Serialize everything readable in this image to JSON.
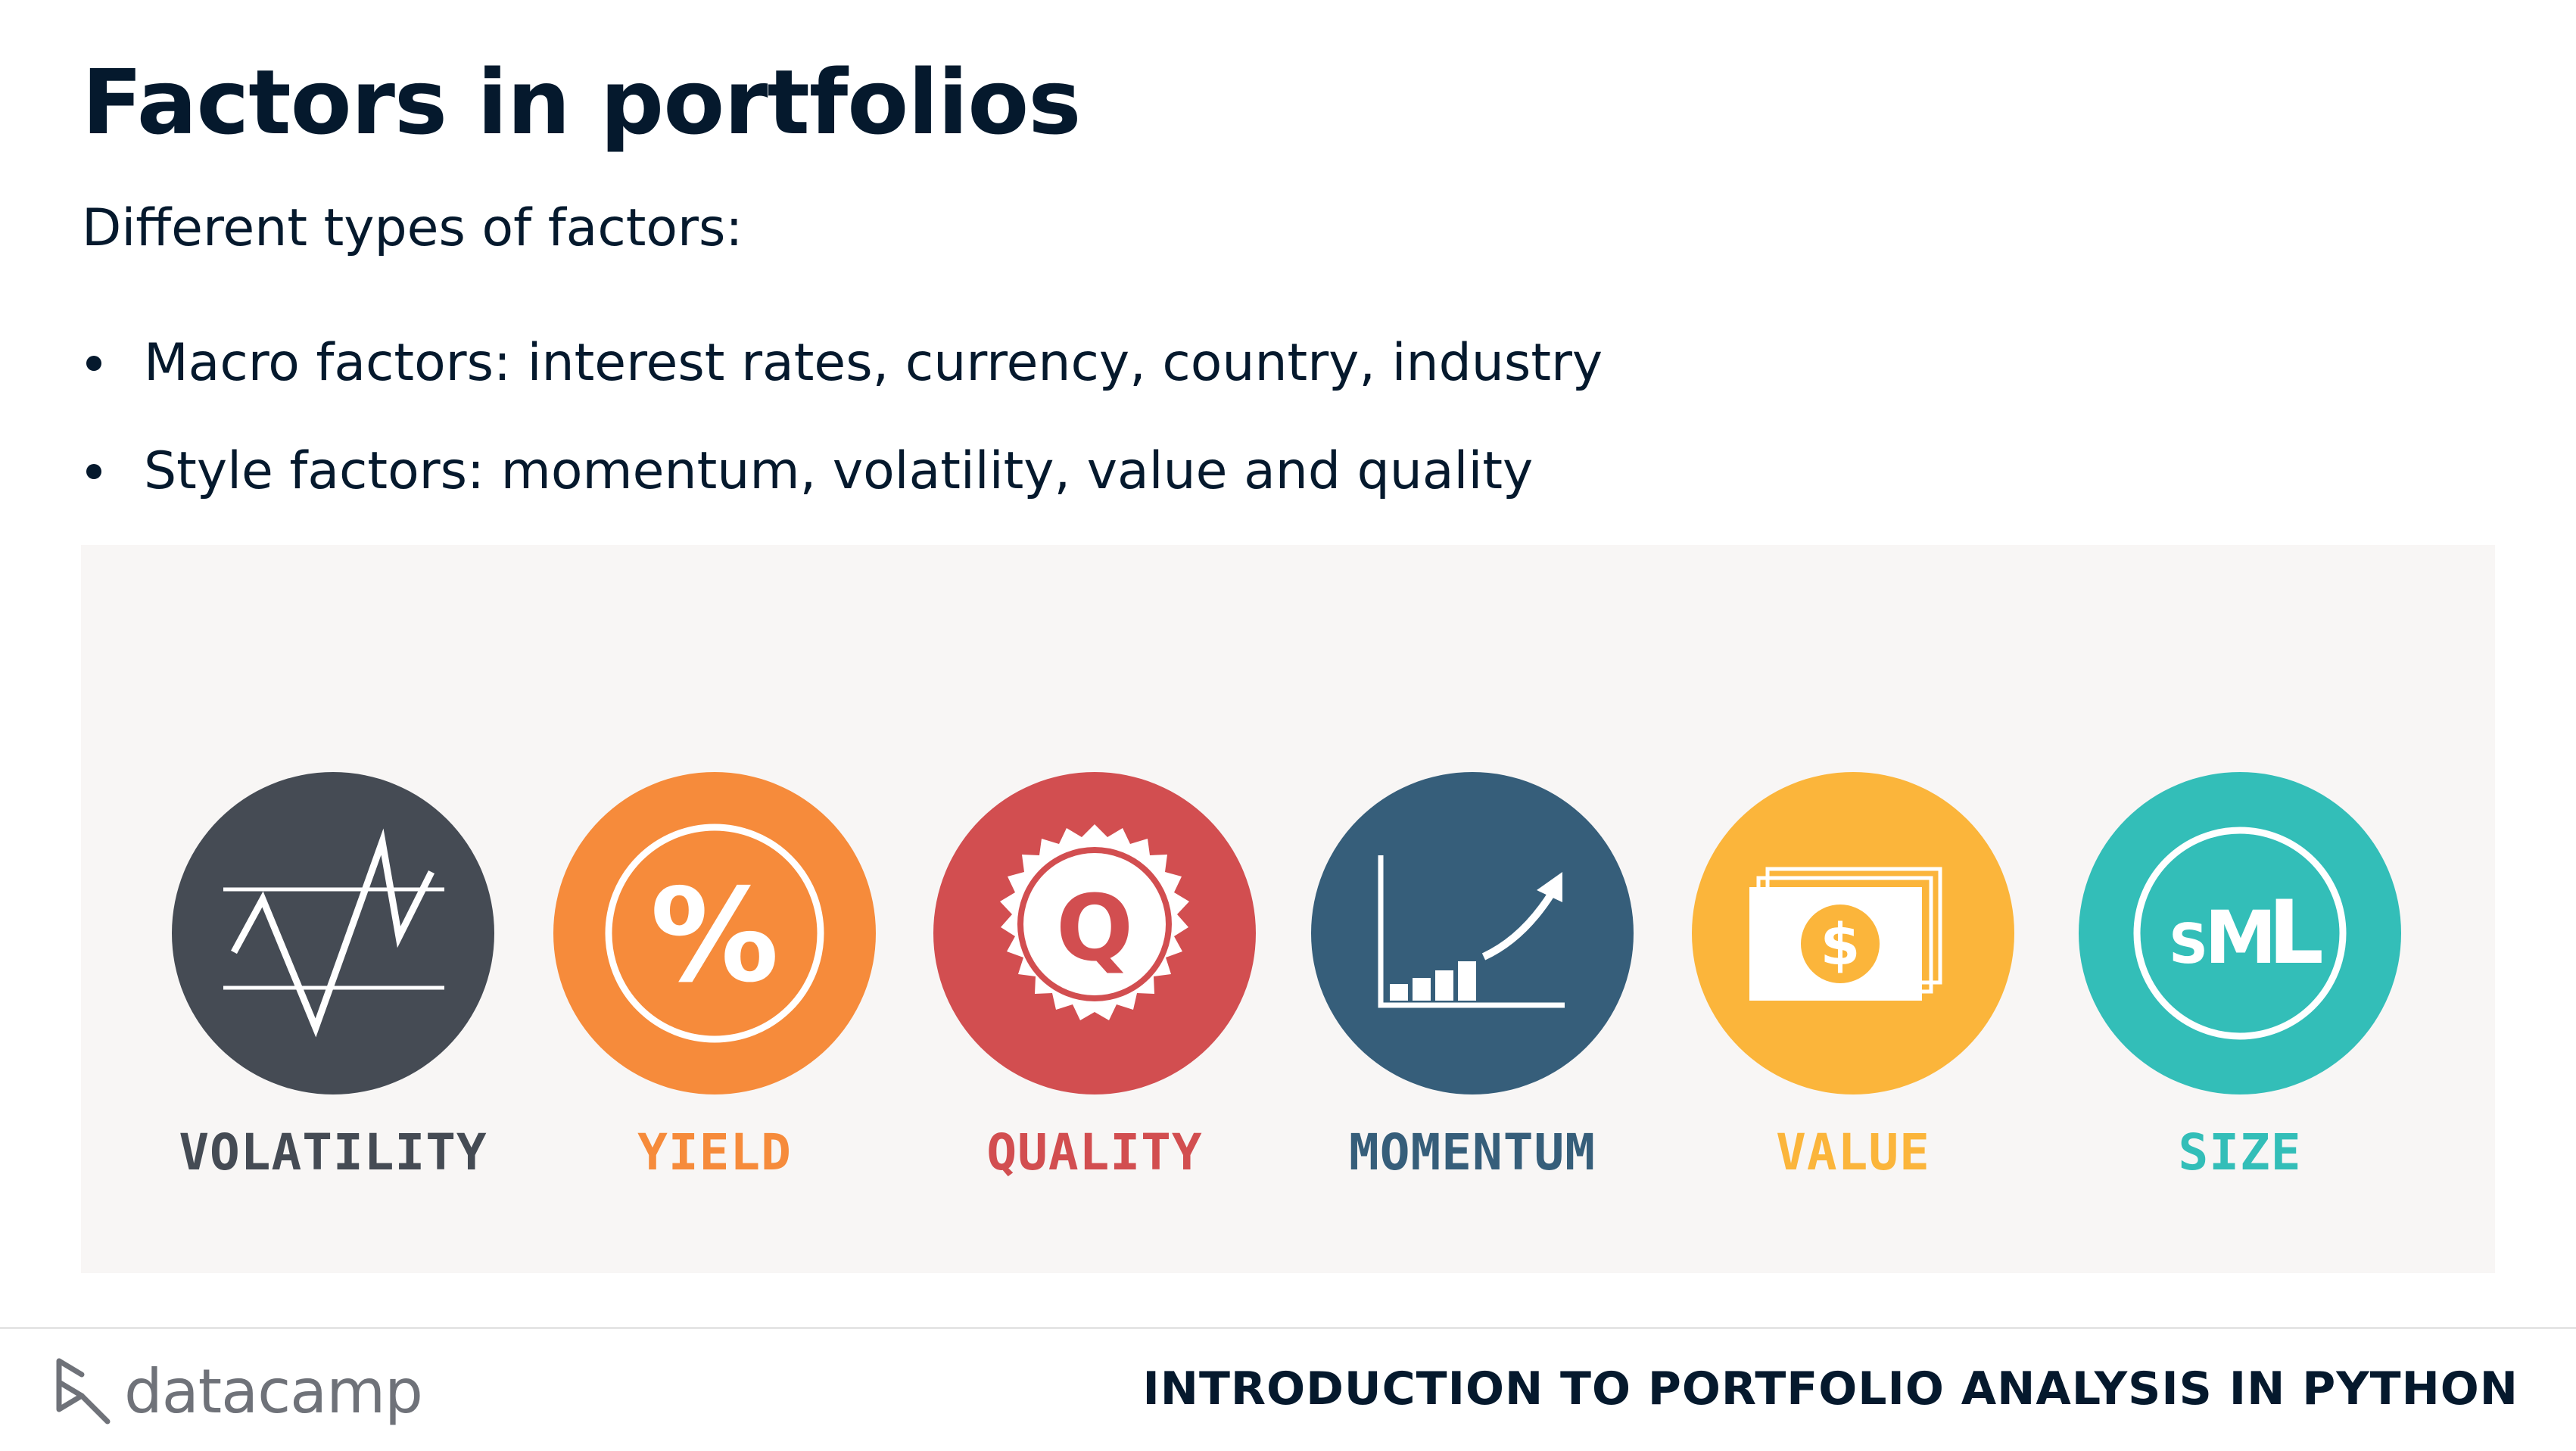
{
  "slide": {
    "title": "Factors in portfolios",
    "subtitle": "Different types of factors:",
    "bullets": [
      "Macro factors: interest rates, currency, country, industry",
      "Style factors: momentum, volatility, value and quality"
    ]
  },
  "factors": [
    {
      "label": "VOLATILITY",
      "icon": "volatility-icon",
      "color": "#454b54"
    },
    {
      "label": "YIELD",
      "icon": "percent-icon",
      "color": "#f68b3b",
      "glyph": "%"
    },
    {
      "label": "QUALITY",
      "icon": "quality-seal-icon",
      "color": "#d24e50",
      "glyph": "Q"
    },
    {
      "label": "MOMENTUM",
      "icon": "momentum-chart-icon",
      "color": "#365e7a"
    },
    {
      "label": "VALUE",
      "icon": "dollar-bill-icon",
      "color": "#fbb53b",
      "glyph": "$"
    },
    {
      "label": "SIZE",
      "icon": "size-sml-icon",
      "color": "#33beb8",
      "glyph_s": "S",
      "glyph_m": "M",
      "glyph_l": "L"
    }
  ],
  "footer": {
    "logo_text": "datacamp",
    "course_title": "INTRODUCTION TO PORTFOLIO ANALYSIS IN PYTHON"
  }
}
